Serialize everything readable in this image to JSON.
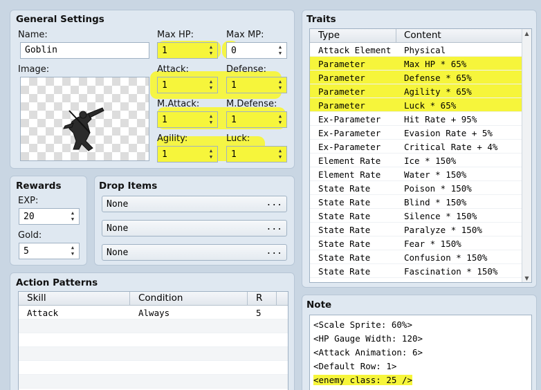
{
  "general": {
    "title": "General Settings",
    "name_label": "Name:",
    "name_value": "Goblin",
    "image_label": "Image:",
    "maxhp_label": "Max HP:",
    "maxhp_value": "1",
    "maxmp_label": "Max MP:",
    "maxmp_value": "0",
    "attack_label": "Attack:",
    "attack_value": "1",
    "defense_label": "Defense:",
    "defense_value": "1",
    "matk_label": "M.Attack:",
    "matk_value": "1",
    "mdef_label": "M.Defense:",
    "mdef_value": "1",
    "agility_label": "Agility:",
    "agility_value": "1",
    "luck_label": "Luck:",
    "luck_value": "1"
  },
  "rewards": {
    "title": "Rewards",
    "exp_label": "EXP:",
    "exp_value": "20",
    "gold_label": "Gold:",
    "gold_value": "5"
  },
  "drops": {
    "title": "Drop Items",
    "items": [
      "None",
      "None",
      "None"
    ],
    "dots": "..."
  },
  "actions": {
    "title": "Action Patterns",
    "columns": [
      "Skill",
      "Condition",
      "R"
    ],
    "rows": [
      {
        "skill": "Attack",
        "condition": "Always",
        "r": "5"
      }
    ]
  },
  "traits": {
    "title": "Traits",
    "columns": [
      "Type",
      "Content"
    ],
    "rows": [
      {
        "type": "Attack Element",
        "content": "Physical"
      },
      {
        "type": "Parameter",
        "content": "Max HP * 65%"
      },
      {
        "type": "Parameter",
        "content": "Defense * 65%"
      },
      {
        "type": "Parameter",
        "content": "Agility * 65%"
      },
      {
        "type": "Parameter",
        "content": "Luck * 65%"
      },
      {
        "type": "Ex-Parameter",
        "content": "Hit Rate + 95%"
      },
      {
        "type": "Ex-Parameter",
        "content": "Evasion Rate + 5%"
      },
      {
        "type": "Ex-Parameter",
        "content": "Critical Rate + 4%"
      },
      {
        "type": "Element Rate",
        "content": "Ice * 150%"
      },
      {
        "type": "Element Rate",
        "content": "Water * 150%"
      },
      {
        "type": "State Rate",
        "content": "Poison * 150%"
      },
      {
        "type": "State Rate",
        "content": "Blind * 150%"
      },
      {
        "type": "State Rate",
        "content": "Silence * 150%"
      },
      {
        "type": "State Rate",
        "content": "Paralyze * 150%"
      },
      {
        "type": "State Rate",
        "content": "Fear * 150%"
      },
      {
        "type": "State Rate",
        "content": "Confusion * 150%"
      },
      {
        "type": "State Rate",
        "content": "Fascination * 150%"
      }
    ]
  },
  "note": {
    "title": "Note",
    "lines": [
      "<Scale Sprite: 60%>",
      "<HP Gauge Width: 120>",
      "<Attack Animation: 6>",
      "<Default Row: 1>",
      "<enemy class: 25 />"
    ]
  },
  "colors": {
    "highlight": "#f6f53b",
    "panel": "#dfe8f1",
    "background": "#c9d6e3"
  },
  "icons": {
    "spin_arrows": "up-down-arrow-icon",
    "more": "ellipsis-icon",
    "scroll": "scroll-arrow-icon"
  }
}
